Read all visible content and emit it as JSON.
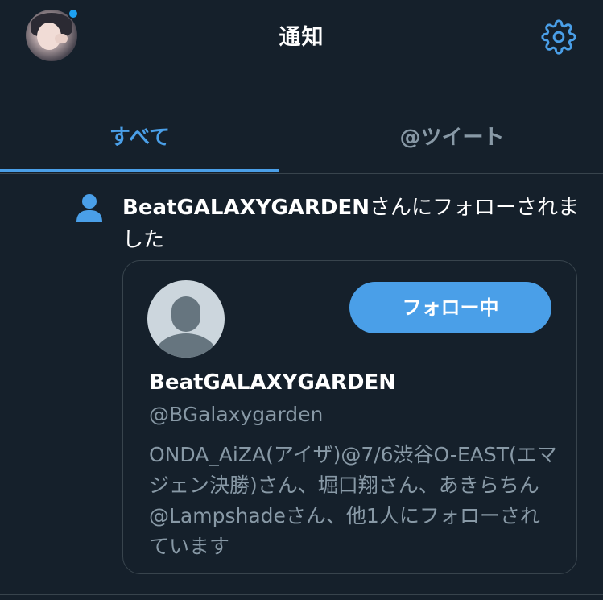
{
  "header": {
    "title": "通知",
    "avatar_icon": "user-avatar",
    "settings_icon": "gear-icon"
  },
  "tabs": [
    {
      "label": "すべて",
      "active": true
    },
    {
      "label": "@ツイート",
      "active": false
    }
  ],
  "notification": {
    "icon": "person-icon",
    "user_name": "BeatGALAXYGARDEN",
    "message": "さんにフォローされました"
  },
  "card": {
    "follow_label": "フォロー中",
    "display_name": "BeatGALAXYGARDEN",
    "handle": "@BGalaxygarden",
    "followed_by": "ONDA_AiZA(アイザ)@7/6渋谷O-EAST(エマジェン決勝)さん、堀口翔さん、あきらちん@Lampshadeさん、他1人にフォローされています"
  },
  "colors": {
    "background": "#15202b",
    "accent": "#4a9fe8",
    "secondary_text": "#8899a6",
    "divider": "#38444d"
  }
}
